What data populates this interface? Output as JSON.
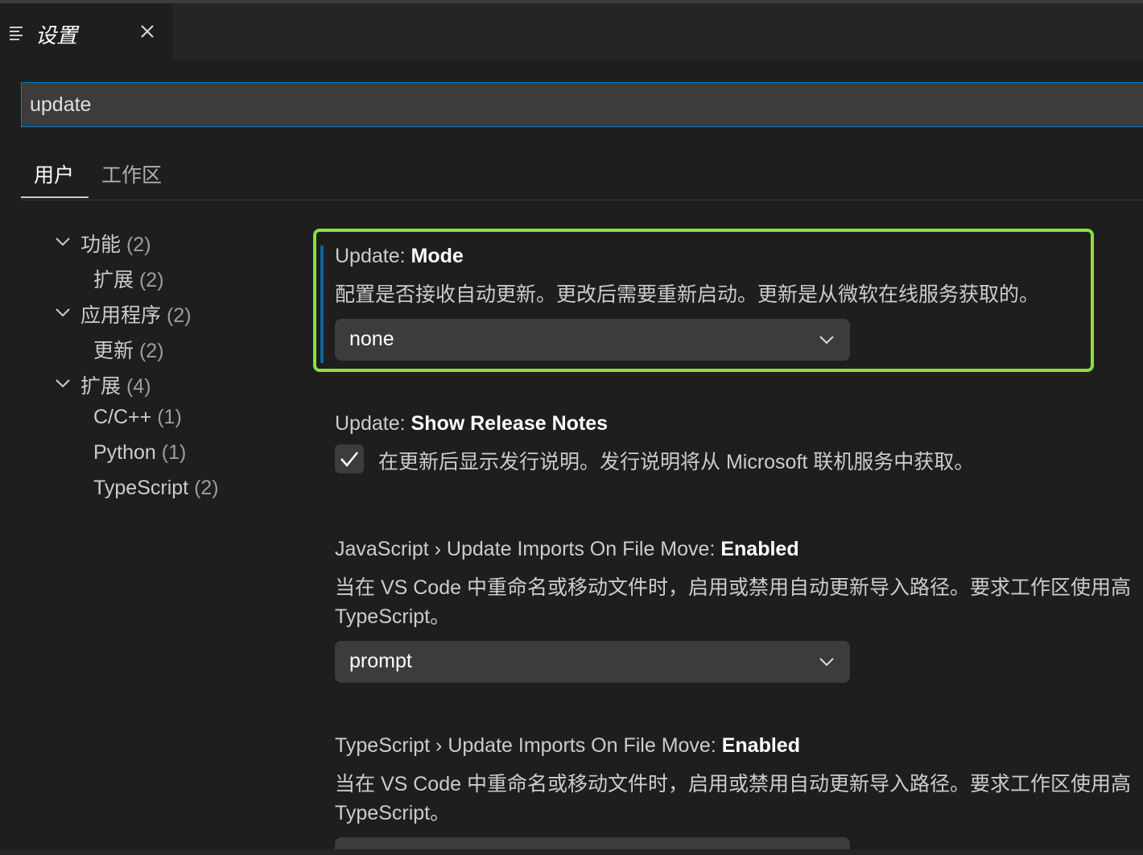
{
  "editor_tab": {
    "title": "设置",
    "icon": "list-icon",
    "close_icon": "close-icon"
  },
  "search": {
    "value": "update"
  },
  "scope_tabs": [
    {
      "label": "用户",
      "active": true
    },
    {
      "label": "工作区",
      "active": false
    }
  ],
  "toc": [
    {
      "label": "功能",
      "count": "(2)",
      "level": 0,
      "expanded": true
    },
    {
      "label": "扩展",
      "count": "(2)",
      "level": 1
    },
    {
      "label": "应用程序",
      "count": "(2)",
      "level": 0,
      "expanded": true
    },
    {
      "label": "更新",
      "count": "(2)",
      "level": 1
    },
    {
      "label": "扩展",
      "count": "(4)",
      "level": 0,
      "expanded": true
    },
    {
      "label": "C/C++",
      "count": "(1)",
      "level": 1
    },
    {
      "label": "Python",
      "count": "(1)",
      "level": 1
    },
    {
      "label": "TypeScript",
      "count": "(2)",
      "level": 1
    }
  ],
  "settings": {
    "update_mode": {
      "category": "Update: ",
      "name": "Mode",
      "description": "配置是否接收自动更新。更改后需要重新启动。更新是从微软在线服务获取的。",
      "value": "none"
    },
    "show_release_notes": {
      "category": "Update: ",
      "name": "Show Release Notes",
      "description": "在更新后显示发行说明。发行说明将从 Microsoft 联机服务中获取。",
      "checked": true
    },
    "js_update_imports": {
      "category": "JavaScript › Update Imports On File Move: ",
      "name": "Enabled",
      "description_line1": "当在 VS Code 中重命名或移动文件时，启用或禁用自动更新导入路径。要求工作区使用高",
      "description_line2": "TypeScript。",
      "value": "prompt"
    },
    "ts_update_imports": {
      "category": "TypeScript › Update Imports On File Move: ",
      "name": "Enabled",
      "description_line1": "当在 VS Code 中重命名或移动文件时，启用或禁用自动更新导入路径。要求工作区使用高",
      "description_line2": "TypeScript。"
    }
  },
  "colors": {
    "focus_outline": "#8ddf3e",
    "accent": "#007fd4",
    "background": "#1e1e1e"
  }
}
